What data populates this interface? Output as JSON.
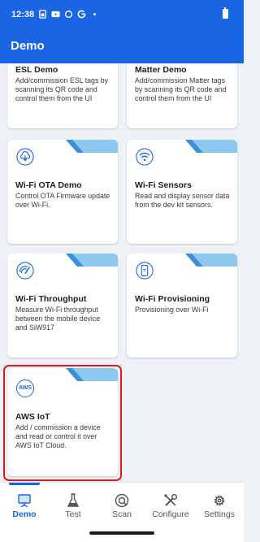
{
  "status_bar": {
    "time": "12:38",
    "icons": [
      "sim-icon",
      "youtube-icon",
      "sync-icon",
      "google-icon",
      "dot-icon"
    ],
    "battery_icon": "battery-icon"
  },
  "app_bar": {
    "title": "Demo"
  },
  "colors": {
    "primary": "#1a65e3",
    "ribbon": "#8fc8ee",
    "highlight": "#e0191d",
    "background": "#eef1f5"
  },
  "cards": [
    {
      "title": "ESL Demo",
      "description": "Add/commission ESL tags by scanning its QR code and control them from the UI"
    },
    {
      "title": "Matter Demo",
      "description": "Add/commission Matter tags by scanning its QR code and control them from the UI"
    },
    {
      "title": "Wi-Fi OTA Demo",
      "description": "Control OTA Firmware update over Wi-Fi.",
      "icon": "cloud-download-icon"
    },
    {
      "title": "Wi-Fi Sensors",
      "description": "Read and display sensor data from the dev kit sensors.",
      "icon": "wifi-icon"
    },
    {
      "title": "Wi-Fi Throughput",
      "description": "Measure Wi-Fi throughput between the mobile device and SiW917",
      "icon": "speedometer-icon"
    },
    {
      "title": "Wi-Fi Provisioning",
      "description": "Provisioning over Wi-Fi",
      "icon": "phone-wifi-icon"
    },
    {
      "title": "AWS IoT",
      "description": "Add / commission a device and read or control it over AWS IoT Cloud.",
      "icon": "aws-icon",
      "icon_text": "AWS",
      "highlighted": true
    }
  ],
  "nav": [
    {
      "label": "Demo",
      "icon": "easel-icon",
      "active": true
    },
    {
      "label": "Test",
      "icon": "flask-icon",
      "active": false
    },
    {
      "label": "Scan",
      "icon": "scan-icon",
      "active": false
    },
    {
      "label": "Configure",
      "icon": "tools-icon",
      "active": false
    },
    {
      "label": "Settings",
      "icon": "gear-icon",
      "active": false
    }
  ]
}
